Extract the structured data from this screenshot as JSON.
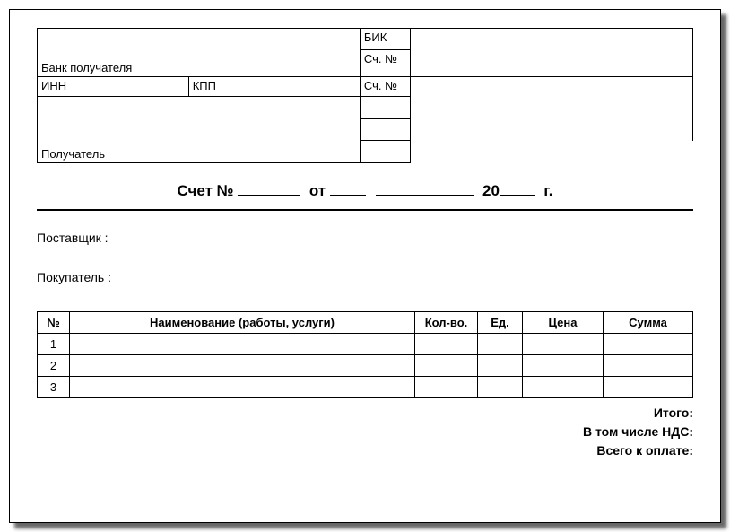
{
  "bank_section": {
    "bank_recipient_label": "Банк получателя",
    "bik_label": "БИК",
    "account_label": "Сч. №",
    "inn_label": "ИНН",
    "kpp_label": "КПП",
    "account_label2": "Сч. №",
    "recipient_label": "Получатель",
    "bank_recipient_value": "",
    "bik_value": "",
    "bank_account_value": "",
    "inn_value": "",
    "kpp_value": "",
    "account_value": "",
    "recipient_value": ""
  },
  "title": {
    "prefix": "Счет №",
    "from": "от",
    "year_prefix": "20",
    "year_suffix": "г.",
    "number": "",
    "day": "",
    "month": "",
    "year": ""
  },
  "parties": {
    "supplier_label": "Поставщик :",
    "buyer_label": "Покупатель :",
    "supplier_value": "",
    "buyer_value": ""
  },
  "items": {
    "headers": {
      "num": "№",
      "name": "Наименование (работы, услуги)",
      "qty": "Кол-во.",
      "unit": "Ед.",
      "price": "Цена",
      "sum": "Сумма"
    },
    "rows": [
      {
        "num": "1",
        "name": "",
        "qty": "",
        "unit": "",
        "price": "",
        "sum": ""
      },
      {
        "num": "2",
        "name": "",
        "qty": "",
        "unit": "",
        "price": "",
        "sum": ""
      },
      {
        "num": "3",
        "name": "",
        "qty": "",
        "unit": "",
        "price": "",
        "sum": ""
      }
    ]
  },
  "totals": {
    "subtotal_label": "Итого:",
    "vat_label": "В том числе НДС:",
    "total_label": "Всего к оплате:",
    "subtotal": "",
    "vat": "",
    "total": ""
  }
}
